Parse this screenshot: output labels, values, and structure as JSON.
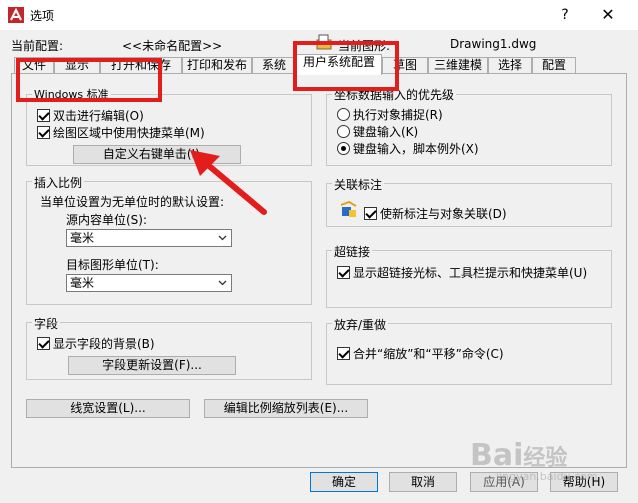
{
  "window": {
    "title": "选项",
    "help_symbol": "?",
    "close_symbol": "✕"
  },
  "header": {
    "current_profile_label": "当前配置:",
    "current_profile_value": "<<未命名配置>>",
    "current_drawing_label": "当前图形:",
    "current_drawing_value": "Drawing1.dwg"
  },
  "tabs": [
    {
      "label": "文件"
    },
    {
      "label": "显示"
    },
    {
      "label": "打开和保存"
    },
    {
      "label": "打印和发布"
    },
    {
      "label": "系统"
    },
    {
      "label": "用户系统配置",
      "active": true
    },
    {
      "label": "草图"
    },
    {
      "label": "三维建模"
    },
    {
      "label": "选择"
    },
    {
      "label": "配置"
    }
  ],
  "windows_standard": {
    "title": "Windows 标准",
    "double_click_edit": "双击进行编辑(O)",
    "shortcut_menu": "绘图区域中使用快捷菜单(M)",
    "custom_right_click_button": "自定义右键单击(I)..."
  },
  "insert_scale": {
    "title": "插入比例",
    "description": "当单位设置为无单位时的默认设置:",
    "source_units_label": "源内容单位(S):",
    "source_units_value": "毫米",
    "target_units_label": "目标图形单位(T):",
    "target_units_value": "毫米"
  },
  "fields": {
    "title": "字段",
    "show_background": "显示字段的背景(B)",
    "update_settings_button": "字段更新设置(F)..."
  },
  "bottom_left_buttons": {
    "lineweight": "线宽设置(L)...",
    "scale_list": "编辑比例缩放列表(E)..."
  },
  "coord_priority": {
    "title": "坐标数据输入的优先级",
    "option1": "执行对象捕捉(R)",
    "option2": "键盘输入(K)",
    "option3": "键盘输入，脚本例外(X)"
  },
  "associative_dim": {
    "title": "关联标注",
    "make_associative": "使新标注与对象关联(D)"
  },
  "hyperlink": {
    "title": "超链接",
    "show_cursor": "显示超链接光标、工具栏提示和快捷菜单(U)"
  },
  "undo_redo": {
    "title": "放弃/重做",
    "combine_zoom_pan": "合并“缩放”和“平移”命令(C)"
  },
  "footer": {
    "ok": "确定",
    "cancel": "取消",
    "apply": "应用(A)",
    "help": "帮助(H)"
  },
  "watermark": {
    "brand": "Bai",
    "brand2": "经验",
    "url": "jingyan.baidu.com"
  },
  "colors": {
    "annotation_red": "#e31c1c",
    "accent_blue": "#0078d7"
  }
}
